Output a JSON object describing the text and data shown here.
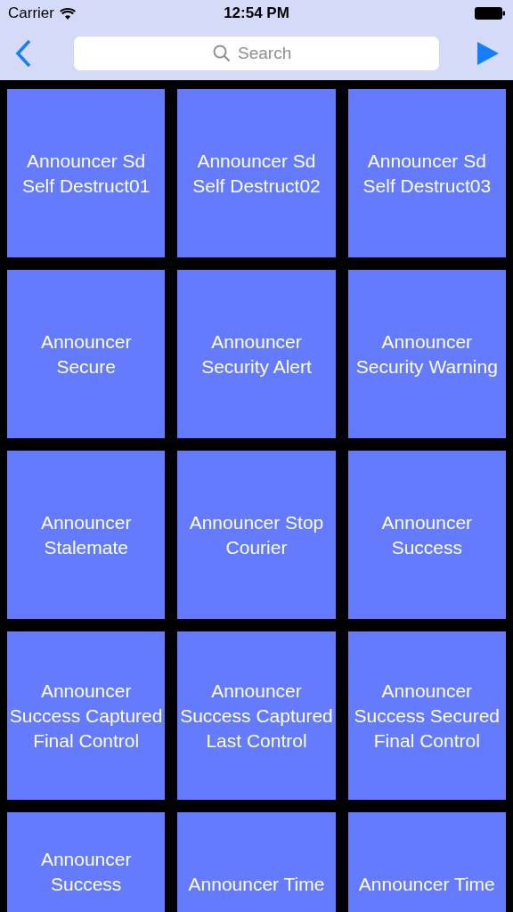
{
  "status_bar": {
    "carrier": "Carrier",
    "time": "12:54 PM"
  },
  "nav_bar": {
    "search": {
      "placeholder": "Search"
    }
  },
  "tiles": [
    {
      "label": "Announcer Sd Self Destruct01"
    },
    {
      "label": "Announcer Sd Self Destruct02"
    },
    {
      "label": "Announcer Sd Self Destruct03"
    },
    {
      "label": "Announcer Secure"
    },
    {
      "label": "Announcer Security Alert"
    },
    {
      "label": "Announcer Security Warning"
    },
    {
      "label": "Announcer Stalemate"
    },
    {
      "label": "Announcer Stop Courier"
    },
    {
      "label": "Announcer Success"
    },
    {
      "label": "Announcer Success Captured Final Control"
    },
    {
      "label": "Announcer Success Captured Last Control"
    },
    {
      "label": "Announcer Success Secured Final Control"
    },
    {
      "label": "Announcer Success",
      "clipped": true
    },
    {
      "label": "Announcer Time",
      "clipped": true
    },
    {
      "label": "Announcer Time",
      "clipped": true
    }
  ]
}
